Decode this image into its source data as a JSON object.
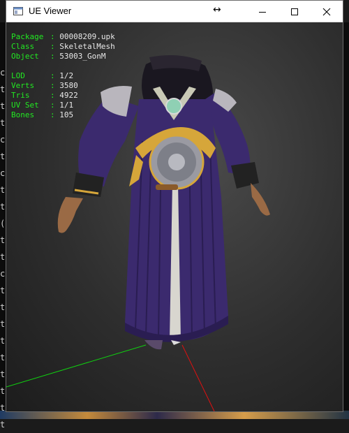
{
  "window": {
    "title": "UE Viewer",
    "resize_cursor_glyph": "↔",
    "controls": [
      "minimize-icon",
      "maximize-icon",
      "close-icon"
    ]
  },
  "info": {
    "package_label": "Package",
    "package_sep": ":",
    "package_value": "00008209.upk",
    "class_label": "Class",
    "class_sep": ":",
    "class_value": "SkeletalMesh",
    "object_label": "Object",
    "object_sep": ":",
    "object_value": "53003_GonM",
    "lod_label": "LOD",
    "lod_sep": ":",
    "lod_value": "1/2",
    "verts_label": "Verts",
    "verts_sep": ":",
    "verts_value": "3580",
    "tris_label": "Tris",
    "tris_sep": ":",
    "tris_value": "4922",
    "uvset_label": "UV Set",
    "uvset_sep": ":",
    "uvset_value": "1/1",
    "bones_label": "Bones",
    "bones_sep": ":",
    "bones_value": "105"
  },
  "background": {
    "left_column_chars": "c\nt\nt\nt\nc\nt\nc\nt\nt\n(\nt\nt\nc\nt\nt\nt\nt\nt\nt\nt\nt\nt"
  },
  "colors": {
    "info_label": "#22e822",
    "info_value": "#e8e8e8",
    "axis_x": "#e01010",
    "axis_y": "#10d010",
    "robe_purple": "#3b2a6e",
    "gold": "#d6a63a"
  },
  "model": {
    "description_icon": "robed-character-mesh"
  }
}
